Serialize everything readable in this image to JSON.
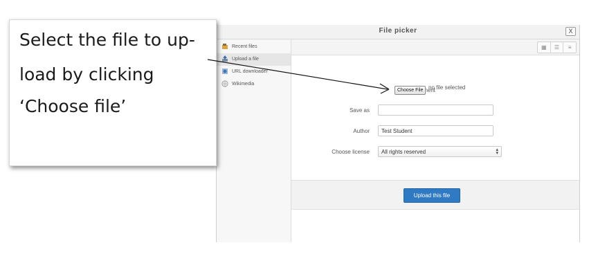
{
  "dialog": {
    "title": "File picker",
    "close_label": "X",
    "repositories": [
      {
        "label": "Recent files",
        "icon": "recent-files-icon",
        "active": false
      },
      {
        "label": "Upload a file",
        "icon": "upload-icon",
        "active": true
      },
      {
        "label": "URL downloader",
        "icon": "url-downloader-icon",
        "active": false
      },
      {
        "label": "Wikimedia",
        "icon": "wikimedia-icon",
        "active": false
      }
    ],
    "view_buttons": [
      "icons-view-icon",
      "list-view-icon",
      "tree-view-icon"
    ],
    "form": {
      "attachment_label": "Attachment",
      "choose_file_label": "Choose File",
      "no_file_text": "no file selected",
      "save_as_label": "Save as",
      "save_as_value": "",
      "author_label": "Author",
      "author_value": "Test Student",
      "license_label": "Choose license",
      "license_value": "All rights reserved"
    },
    "upload_button_label": "Upload this file"
  },
  "callout": {
    "lines": [
      "Select the file to up-",
      "load by clicking",
      "‘Choose file’"
    ]
  }
}
